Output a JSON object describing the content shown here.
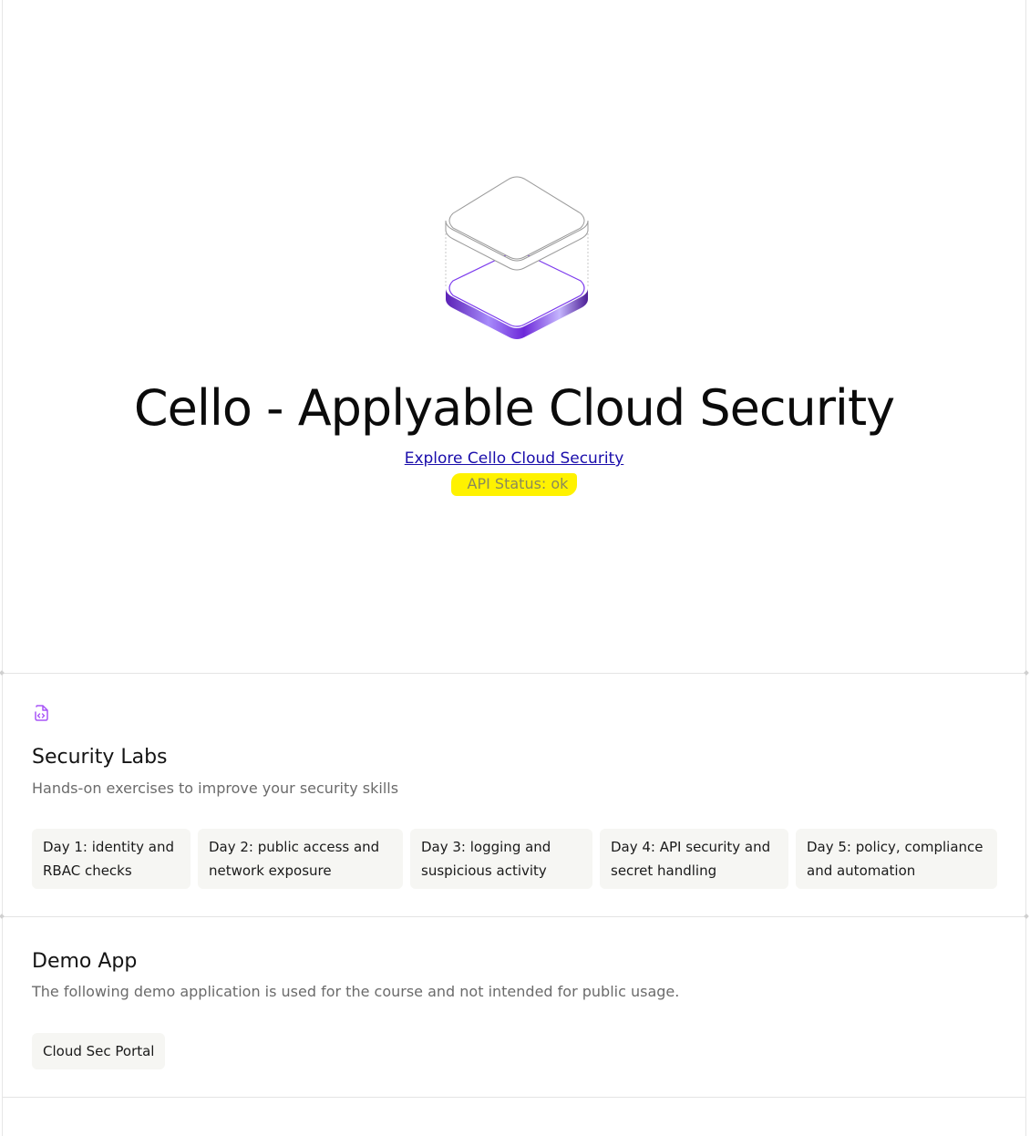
{
  "hero": {
    "logo_icon": "stacked-layers-logo",
    "title": "Cello - Applyable Cloud Security",
    "link_text": "Explore Cello Cloud Security",
    "api_status": "API Status: ok"
  },
  "labs": {
    "icon": "code-file-icon",
    "title": "Security Labs",
    "subtitle": "Hands-on exercises to improve your security skills",
    "items": [
      {
        "label": "Day 1: identity and RBAC checks"
      },
      {
        "label": "Day 2: public access and network exposure"
      },
      {
        "label": "Day 3: logging and suspicious activity"
      },
      {
        "label": "Day 4: API security and secret handling"
      },
      {
        "label": "Day 5: policy, compliance and automation"
      }
    ]
  },
  "demo": {
    "title": "Demo App",
    "subtitle": "The following demo application is used for the course and not intended for public usage.",
    "items": [
      {
        "label": "Cloud Sec Portal"
      }
    ]
  },
  "colors": {
    "accent": "#7c3aed",
    "highlight": "#fff200",
    "link": "#1a0dab"
  }
}
